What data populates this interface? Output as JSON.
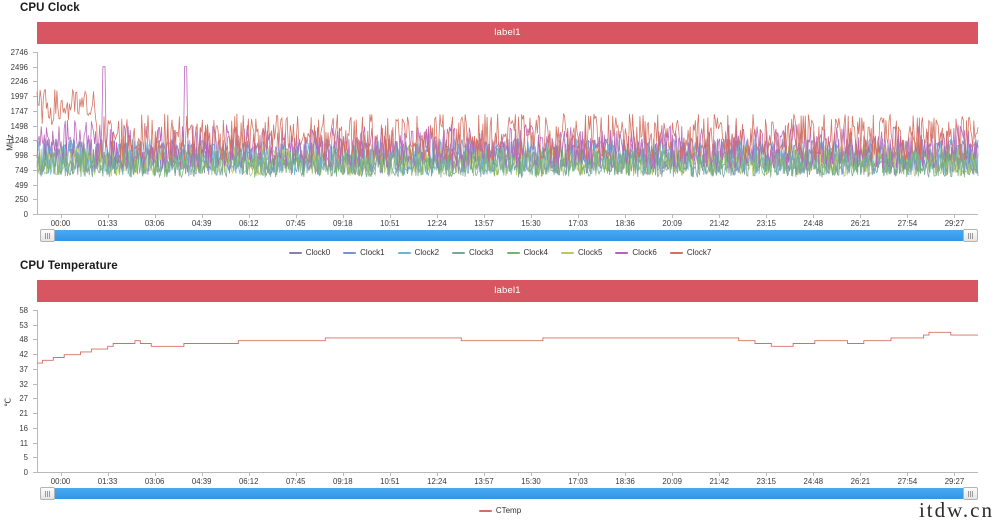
{
  "watermark": "itdw.cn",
  "panels": [
    {
      "id": "cpu-clock",
      "title": "CPU Clock",
      "banner_label": "label1",
      "banner_color": "#d85661",
      "y_title": "MHz",
      "y_ticks": [
        "2746",
        "2496",
        "2246",
        "1997",
        "1747",
        "1498",
        "1248",
        "998",
        "749",
        "499",
        "250",
        "0"
      ],
      "x_ticks": [
        "00:00",
        "01:33",
        "03:06",
        "04:39",
        "06:12",
        "07:45",
        "09:18",
        "10:51",
        "12:24",
        "13:57",
        "15:30",
        "17:03",
        "18:36",
        "20:09",
        "21:42",
        "23:15",
        "24:48",
        "26:21",
        "27:54",
        "29:27"
      ],
      "legend": [
        {
          "label": "Clock0",
          "color": "#8780a8"
        },
        {
          "label": "Clock1",
          "color": "#7b93d1"
        },
        {
          "label": "Clock2",
          "color": "#6ab5d8"
        },
        {
          "label": "Clock3",
          "color": "#79a79b"
        },
        {
          "label": "Clock4",
          "color": "#74b371"
        },
        {
          "label": "Clock5",
          "color": "#b9c95d"
        },
        {
          "label": "Clock6",
          "color": "#b862b8"
        },
        {
          "label": "Clock7",
          "color": "#d4705f"
        }
      ],
      "slider": {
        "left_handle": "grip-handle",
        "right_handle": "grip-handle",
        "fill_color": "#3a9ce9",
        "value_start": 0,
        "value_end": 100
      }
    },
    {
      "id": "cpu-temperature",
      "title": "CPU Temperature",
      "banner_label": "label1",
      "banner_color": "#d85661",
      "y_title": "℃",
      "y_ticks": [
        "58",
        "53",
        "48",
        "42",
        "37",
        "32",
        "27",
        "21",
        "16",
        "11",
        "5",
        "0"
      ],
      "x_ticks": [
        "00:00",
        "01:33",
        "03:06",
        "04:39",
        "06:12",
        "07:45",
        "09:18",
        "10:51",
        "12:24",
        "13:57",
        "15:30",
        "17:03",
        "18:36",
        "20:09",
        "21:42",
        "23:15",
        "24:48",
        "26:21",
        "27:54",
        "29:27"
      ],
      "legend": [
        {
          "label": "CTemp",
          "color": "#d4705f"
        }
      ],
      "slider": {
        "left_handle": "grip-handle",
        "right_handle": "grip-handle",
        "fill_color": "#3a9ce9",
        "value_start": 0,
        "value_end": 100
      }
    }
  ],
  "chart_data": [
    {
      "type": "line",
      "title": "CPU Clock",
      "xlabel": "",
      "ylabel": "MHz",
      "ylim": [
        0,
        2746
      ],
      "xlim_labels": [
        "00:00",
        "29:27"
      ],
      "grid": false,
      "legend_position": "bottom",
      "x_tick_labels": [
        "00:00",
        "01:33",
        "03:06",
        "04:39",
        "06:12",
        "07:45",
        "09:18",
        "10:51",
        "12:24",
        "13:57",
        "15:30",
        "17:03",
        "18:36",
        "20:09",
        "21:42",
        "23:15",
        "24:48",
        "26:21",
        "27:54",
        "29:27"
      ],
      "y_tick_values": [
        2746,
        2496,
        2246,
        1997,
        1747,
        1498,
        1248,
        998,
        749,
        499,
        250,
        0
      ],
      "series": [
        {
          "name": "Clock0",
          "color": "#8780a8",
          "note": "low-amplitude, mostly overdrawn",
          "values": [
            998,
            1248,
            998,
            749,
            1248,
            998,
            1248,
            749,
            998,
            1248,
            749,
            998,
            1248,
            998,
            749,
            1248,
            998,
            1248,
            749,
            998,
            1248,
            998,
            749,
            1248,
            998,
            749,
            1248,
            998,
            1248,
            749,
            998,
            1248,
            749,
            998,
            1248,
            998,
            749,
            1248,
            998,
            1248
          ]
        },
        {
          "name": "Clock1",
          "color": "#7b93d1",
          "values": [
            998,
            1248,
            749,
            998,
            1248,
            998,
            749,
            1248,
            998,
            1248,
            749,
            998,
            1248,
            749,
            998,
            1248,
            998,
            749,
            1248,
            998,
            1248,
            749,
            998,
            1248,
            998,
            749,
            1248,
            998,
            1248,
            749,
            998,
            1248,
            749,
            998,
            1248,
            998,
            749,
            1248,
            998,
            1248
          ]
        },
        {
          "name": "Clock2",
          "color": "#6ab5d8",
          "values": [
            749,
            998,
            1248,
            749,
            998,
            1248,
            998,
            749,
            1248,
            998,
            1248,
            749,
            998,
            1248,
            749,
            998,
            1248,
            998,
            749,
            1248,
            998,
            1248,
            749,
            998,
            1248,
            998,
            749,
            1248,
            998,
            1248,
            749,
            998,
            1248,
            749,
            998,
            1248,
            998,
            749,
            1248,
            998
          ]
        },
        {
          "name": "Clock3",
          "color": "#79a79b",
          "values": [
            749,
            998,
            749,
            1248,
            998,
            749,
            1248,
            998,
            749,
            998,
            1248,
            749,
            998,
            749,
            1248,
            998,
            749,
            1248,
            998,
            749,
            998,
            1248,
            749,
            998,
            749,
            1248,
            998,
            749,
            1248,
            998,
            749,
            998,
            1248,
            749,
            998,
            749,
            1248,
            998,
            749,
            998
          ]
        },
        {
          "name": "Clock4",
          "color": "#74b371",
          "values": [
            749,
            998,
            749,
            1248,
            749,
            998,
            749,
            1248,
            998,
            749,
            998,
            749,
            1248,
            749,
            998,
            749,
            1248,
            998,
            749,
            998,
            749,
            1248,
            749,
            998,
            749,
            1248,
            998,
            749,
            998,
            749,
            1248,
            749,
            998,
            749,
            1248,
            998,
            749,
            998,
            749,
            1248
          ]
        },
        {
          "name": "Clock5",
          "color": "#b9c95d",
          "values": [
            749,
            998,
            749,
            998,
            1248,
            749,
            998,
            749,
            1248,
            998,
            749,
            998,
            749,
            998,
            1248,
            749,
            998,
            749,
            1248,
            998,
            749,
            998,
            749,
            998,
            1248,
            749,
            998,
            749,
            1248,
            998,
            749,
            998,
            749,
            998,
            1248,
            749,
            998,
            749,
            1248,
            998
          ]
        },
        {
          "name": "Clock6",
          "color": "#b862b8",
          "peak_values": [
            2496,
            2496
          ],
          "values": [
            1498,
            1997,
            1248,
            1498,
            2496,
            1498,
            1248,
            1498,
            1747,
            1498,
            1248,
            1498,
            1747,
            1248,
            1498,
            1747,
            1498,
            1248,
            1498,
            2496,
            1498,
            1747,
            1248,
            1498,
            1747,
            1498,
            1248,
            1747,
            1498,
            1248,
            1498,
            1747,
            1498,
            1248,
            1747,
            1498,
            1248,
            1498,
            1747,
            1498
          ]
        },
        {
          "name": "Clock7",
          "color": "#d4705f",
          "values": [
            1747,
            1997,
            1747,
            1997,
            1747,
            1997,
            1747,
            1997,
            1498,
            1747,
            1498,
            1747,
            1498,
            1747,
            1498,
            1747,
            1498,
            1747,
            1498,
            1747,
            1498,
            1747,
            1498,
            1747,
            1498,
            1747,
            1498,
            1747,
            1498,
            1747,
            1498,
            1747,
            1498,
            1747,
            1498,
            1747,
            1498,
            1747,
            1498,
            1747
          ]
        }
      ],
      "annotations": [
        "two isolated spikes to ~2496 MHz near 02:05 and 04:45 (Clock6)",
        "Clock7 sustained near 1747-1997 MHz for first ~1:45 then drops to 1248-1747 MHz band"
      ]
    },
    {
      "type": "line",
      "title": "CPU Temperature",
      "xlabel": "",
      "ylabel": "℃",
      "ylim": [
        0,
        58
      ],
      "xlim_labels": [
        "00:00",
        "29:27"
      ],
      "grid": false,
      "legend_position": "bottom",
      "x_tick_labels": [
        "00:00",
        "01:33",
        "03:06",
        "04:39",
        "06:12",
        "07:45",
        "09:18",
        "10:51",
        "12:24",
        "13:57",
        "15:30",
        "17:03",
        "18:36",
        "20:09",
        "21:42",
        "23:15",
        "24:48",
        "26:21",
        "27:54",
        "29:27"
      ],
      "y_tick_values": [
        58,
        53,
        48,
        42,
        37,
        32,
        27,
        21,
        16,
        11,
        5,
        0
      ],
      "series": [
        {
          "name": "CTemp",
          "color": "#d4705f",
          "values": [
            39,
            40,
            40,
            41,
            41,
            42,
            42,
            42,
            43,
            43,
            44,
            44,
            44,
            45,
            46,
            46,
            46,
            46,
            47,
            46,
            46,
            45,
            45,
            45,
            45,
            45,
            45,
            46,
            46,
            46,
            46,
            46,
            46,
            46,
            46,
            46,
            46,
            47,
            47,
            47,
            47,
            47,
            47,
            47,
            47,
            47,
            47,
            47,
            47,
            47,
            47,
            47,
            47,
            48,
            48,
            48,
            48,
            48,
            48,
            48,
            48,
            48,
            48,
            48,
            48,
            48,
            48,
            48,
            48,
            48,
            48,
            48,
            48,
            48,
            48,
            48,
            48,
            48,
            47,
            47,
            47,
            47,
            47,
            47,
            47,
            47,
            47,
            47,
            47,
            47,
            47,
            47,
            47,
            48,
            48,
            48,
            48,
            48,
            48,
            48,
            48,
            48,
            48,
            48,
            48,
            48,
            48,
            48,
            48,
            48,
            48,
            48,
            48,
            48,
            48,
            48,
            48,
            48,
            48,
            48,
            48,
            48,
            48,
            48,
            48,
            48,
            48,
            48,
            48,
            47,
            47,
            47,
            46,
            46,
            46,
            45,
            45,
            45,
            45,
            46,
            46,
            46,
            46,
            47,
            47,
            47,
            47,
            47,
            47,
            46,
            46,
            46,
            47,
            47,
            47,
            47,
            47,
            48,
            48,
            48,
            48,
            48,
            48,
            49,
            50,
            50,
            50,
            50,
            49,
            49,
            49,
            49,
            49,
            49
          ]
        }
      ],
      "annotations": [
        "rises from ~39 ℃ to ~48 ℃ in first 2 minutes",
        "plateau near 47-48 ℃ through mid run",
        "dip to ~45 ℃ around 23:15-25:00 then recovery to ~50 ℃ near 28:30"
      ]
    }
  ]
}
